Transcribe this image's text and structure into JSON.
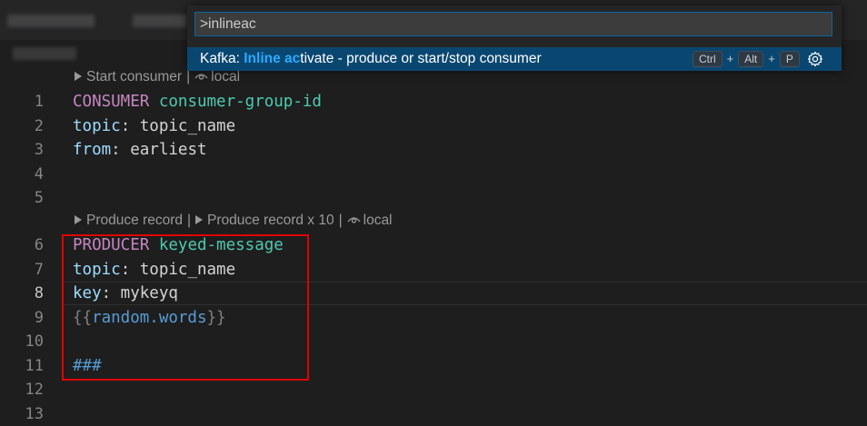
{
  "palette": {
    "input_value": ">inlineac",
    "result": {
      "prefix": "Kafka: ",
      "match1": "Inline ac",
      "rest": "tivate - produce or start/stop consumer"
    },
    "keybinding": [
      "Ctrl",
      "Alt",
      "P"
    ],
    "keybinding_sep": "+",
    "gear_icon": "gear-icon"
  },
  "codelens": {
    "consumer": {
      "start": "Start consumer",
      "local": "local"
    },
    "producer": {
      "produce": "Produce record",
      "produce10": "Produce record x 10",
      "local": "local"
    },
    "separator": "|"
  },
  "lines": [
    {
      "n": "1",
      "kw": "CONSUMER",
      "ident": " consumer-group-id"
    },
    {
      "n": "2",
      "prop": "topic",
      "rest": ": topic_name"
    },
    {
      "n": "3",
      "prop": "from",
      "rest": ": earliest"
    },
    {
      "n": "4"
    },
    {
      "n": "5"
    },
    {
      "n": "6",
      "kw": "PRODUCER",
      "ident": " keyed-message"
    },
    {
      "n": "7",
      "prop": "topic",
      "rest": ": topic_name"
    },
    {
      "n": "8",
      "prop": "key",
      "rest": ": mykeyq"
    },
    {
      "n": "9",
      "brace_open": "{{",
      "var": "random.words",
      "brace_close": "}}"
    },
    {
      "n": "10"
    },
    {
      "n": "11",
      "hash": "###"
    },
    {
      "n": "12"
    },
    {
      "n": "13"
    }
  ],
  "colors": {
    "keyword": "#c586c0",
    "identifier": "#4ec9b0",
    "property": "#9cdcfe",
    "highlight_box": "#e10000",
    "selection": "#094771"
  }
}
